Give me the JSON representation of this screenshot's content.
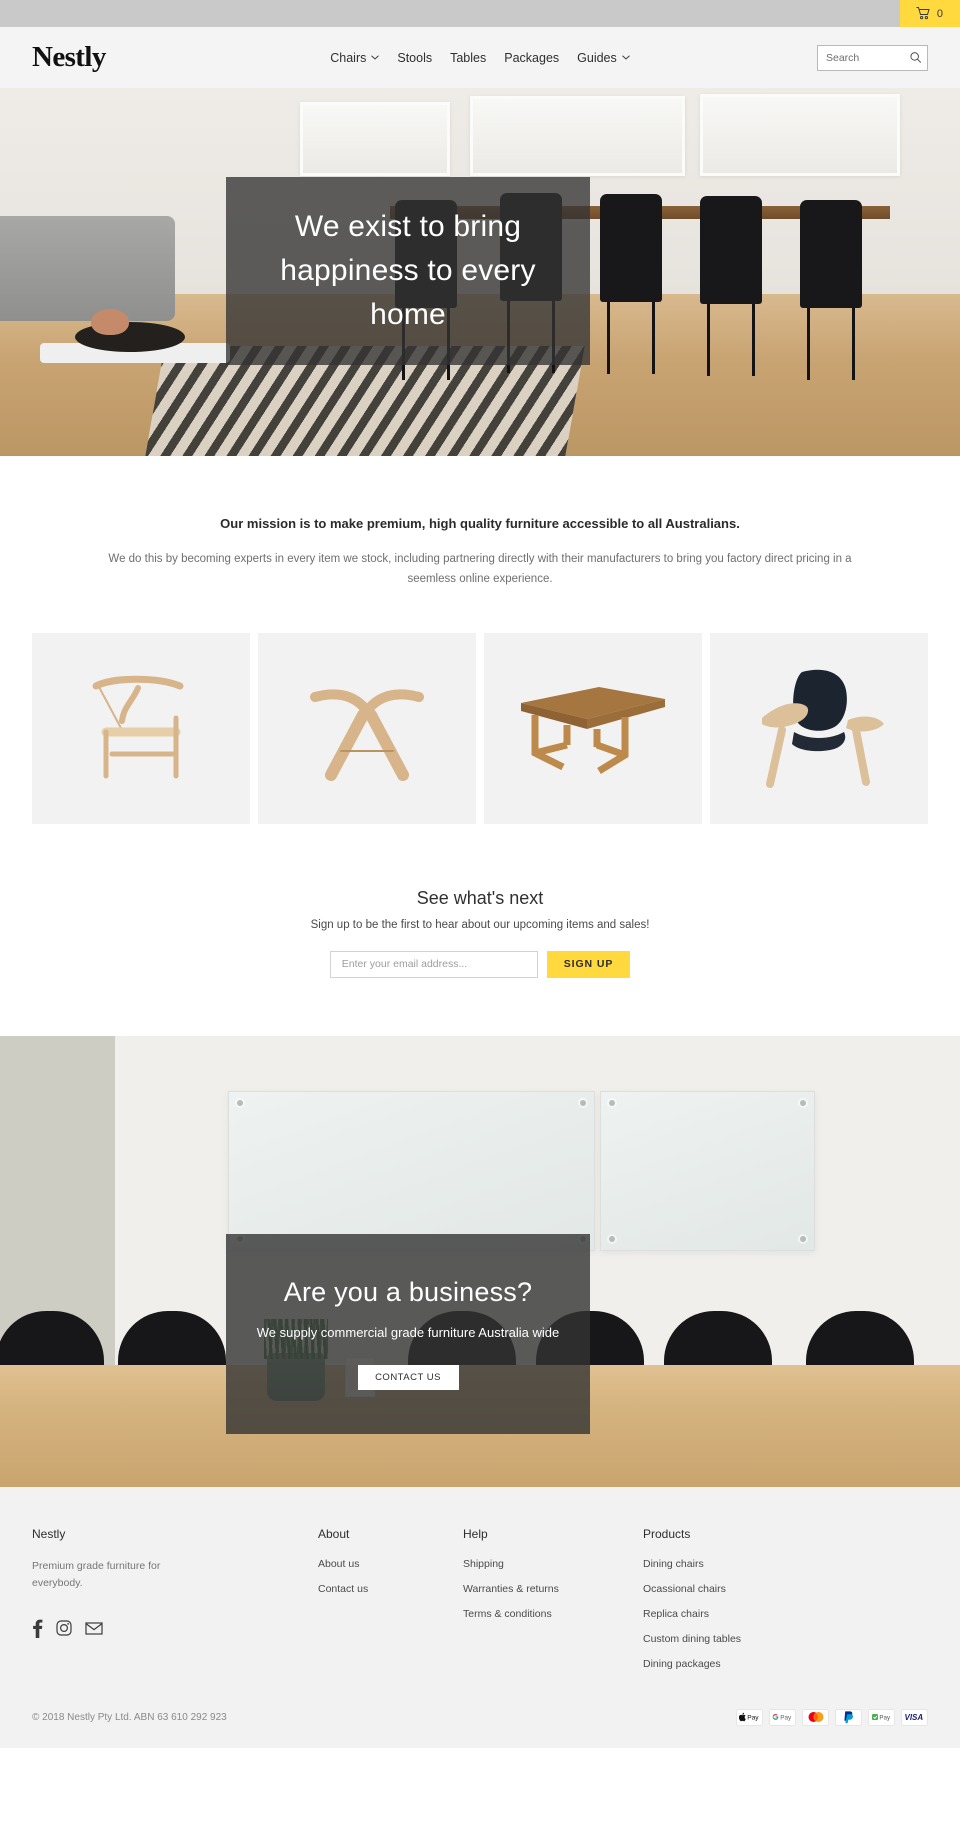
{
  "topbar": {
    "cart_icon": "shopping-cart-icon",
    "cart_count": "0"
  },
  "header": {
    "logo": "Nestly",
    "nav": [
      {
        "label": "Chairs",
        "has_dropdown": true
      },
      {
        "label": "Stools",
        "has_dropdown": false
      },
      {
        "label": "Tables",
        "has_dropdown": false
      },
      {
        "label": "Packages",
        "has_dropdown": false
      },
      {
        "label": "Guides",
        "has_dropdown": true
      }
    ],
    "search": {
      "placeholder": "Search",
      "value": "",
      "icon": "search-icon"
    }
  },
  "hero": {
    "title": "We exist to bring happiness to every home"
  },
  "mission": {
    "heading": "Our mission is to make premium, high quality furniture accessible to all Australians.",
    "body": "We do this by becoming experts in every item we stock, including partnering directly with their manufacturers to bring you factory direct pricing in a seemless online experience."
  },
  "tiles": [
    {
      "name": "wishbone-chair"
    },
    {
      "name": "butterfly-stool"
    },
    {
      "name": "dining-table"
    },
    {
      "name": "shell-chair"
    }
  ],
  "newsletter": {
    "title": "See what's next",
    "subtitle": "Sign up to be the first to hear about our upcoming items and sales!",
    "placeholder": "Enter your email address...",
    "value": "",
    "button": "SIGN UP"
  },
  "business": {
    "title": "Are you a business?",
    "subtitle": "We supply commercial grade furniture Australia wide",
    "button": "CONTACT US"
  },
  "footer": {
    "brand": {
      "title": "Nestly",
      "description": "Premium grade furniture for everybody.",
      "socials": [
        "facebook-icon",
        "instagram-icon",
        "email-icon"
      ]
    },
    "columns": [
      {
        "heading": "About",
        "links": [
          "About us",
          "Contact us"
        ]
      },
      {
        "heading": "Help",
        "links": [
          "Shipping",
          "Warranties & returns",
          "Terms & conditions"
        ]
      },
      {
        "heading": "Products",
        "links": [
          "Dining chairs",
          "Ocassional chairs",
          "Replica chairs",
          "Custom dining tables",
          "Dining packages"
        ]
      }
    ],
    "copyright": "© 2018 Nestly Pty Ltd. ABN 63 610 292 923",
    "payments": [
      "apple-pay",
      "google-pay",
      "mastercard",
      "paypal",
      "afterpay",
      "visa"
    ]
  },
  "colors": {
    "accent": "#ffd93d",
    "topbar": "#c9c9c9",
    "header": "#f4f4f4",
    "overlay": "#333333",
    "footer": "#f2f2f2"
  }
}
